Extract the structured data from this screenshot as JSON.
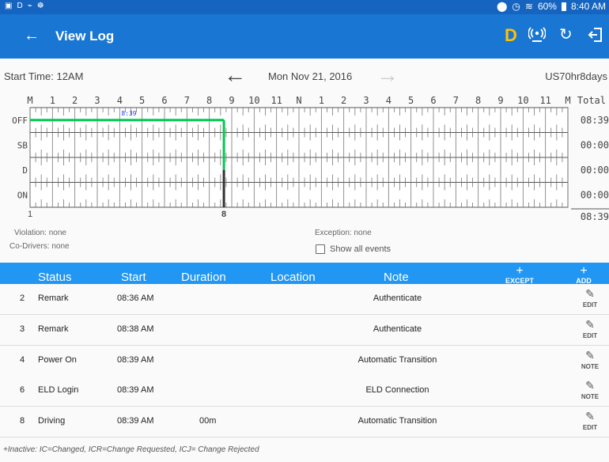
{
  "status_bar": {
    "left_icons": [
      "gallery-icon",
      "d-icon",
      "activity-icon",
      "app-icon"
    ],
    "time": "8:40 AM",
    "battery": "60%"
  },
  "app_bar": {
    "title": "View Log",
    "duty_letter": "D",
    "duty_color": "#ffc107",
    "icons": [
      "back-arrow-icon",
      "bluetooth-signal-icon",
      "refresh-icon",
      "logout-icon"
    ]
  },
  "graph_header": {
    "start_time": "Start Time: 12AM",
    "date": "Mon Nov 21, 2016",
    "ruleset": "US70hr8days"
  },
  "graph": {
    "hour_labels": [
      "M",
      "1",
      "2",
      "3",
      "4",
      "5",
      "6",
      "7",
      "8",
      "9",
      "10",
      "11",
      "N",
      "1",
      "2",
      "3",
      "4",
      "5",
      "6",
      "7",
      "8",
      "9",
      "10",
      "11",
      "M"
    ],
    "rows": [
      "OFF",
      "SB",
      "D",
      "ON"
    ],
    "total_label": "Total",
    "totals": [
      "08:39",
      "00:00",
      "00:00",
      "00:00"
    ],
    "grand_total": "08:39",
    "marker_label": "8:39",
    "bottom_left_label": "1",
    "bottom_marker_label": "8",
    "line_color": "#00c853",
    "segments": [
      {
        "status": "OFF",
        "start_hour": 0,
        "end_hour": 8.65
      },
      {
        "status": "D",
        "start_hour": 8.65,
        "end_hour": 8.65
      }
    ]
  },
  "info": {
    "violation": "Violation: none",
    "co_drivers": "Co-Drivers: none",
    "exception": "Exception: none",
    "show_all_events": "Show all events"
  },
  "table": {
    "headers": {
      "status": "Status",
      "start": "Start",
      "duration": "Duration",
      "location": "Location",
      "note": "Note",
      "except": "EXCEPT",
      "add": "ADD"
    },
    "rows": [
      {
        "idx": "2",
        "status": "Remark",
        "start": "08:36 AM",
        "duration": "",
        "note": "Authenticate",
        "action": "EDIT"
      },
      {
        "idx": "3",
        "status": "Remark",
        "start": "08:38 AM",
        "duration": "",
        "note": "Authenticate",
        "action": "EDIT"
      },
      {
        "idx": "4",
        "status": "Power On",
        "start": "08:39 AM",
        "duration": "",
        "note": "Automatic Transition",
        "action": "NOTE"
      },
      {
        "idx": "6",
        "status": "ELD Login",
        "start": "08:39 AM",
        "duration": "",
        "note": "ELD Connection",
        "action": "NOTE"
      },
      {
        "idx": "8",
        "status": "Driving",
        "start": "08:39 AM",
        "duration": "00m",
        "note": "Automatic Transition",
        "action": "EDIT"
      }
    ],
    "legend": "+Inactive: IC=Changed, ICR=Change Requested, ICJ= Change Rejected"
  },
  "colors": {
    "status_bar": "#1565c0",
    "app_bar": "#1976d2",
    "table_header": "#2196f3"
  }
}
